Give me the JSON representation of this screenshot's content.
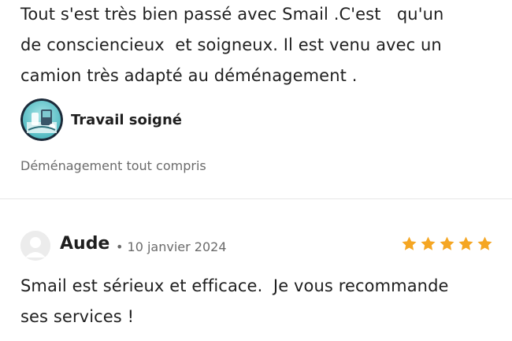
{
  "reviews": [
    {
      "body": "Tout s'est très bien passé avec Smail .C'est   qu'un\nde consciencieux  et soigneux. Il est venu avec un\ncamion très adapté au déménagement .",
      "badge": {
        "label": "Travail soigné",
        "icon": "careful-work-badge-icon"
      },
      "service": "Déménagement tout compris"
    },
    {
      "author": "Aude",
      "date": "• 10 janvier 2024",
      "rating": 5,
      "rating_max": 5,
      "body": "Smail est sérieux et efficace.  Je vous recommande\nses services !"
    }
  ],
  "colors": {
    "star": "#f5a623",
    "text": "#1f1f1f",
    "muted": "#6b6b6b",
    "divider": "#e6e6e6",
    "avatar_bg": "#e9e9e9"
  }
}
